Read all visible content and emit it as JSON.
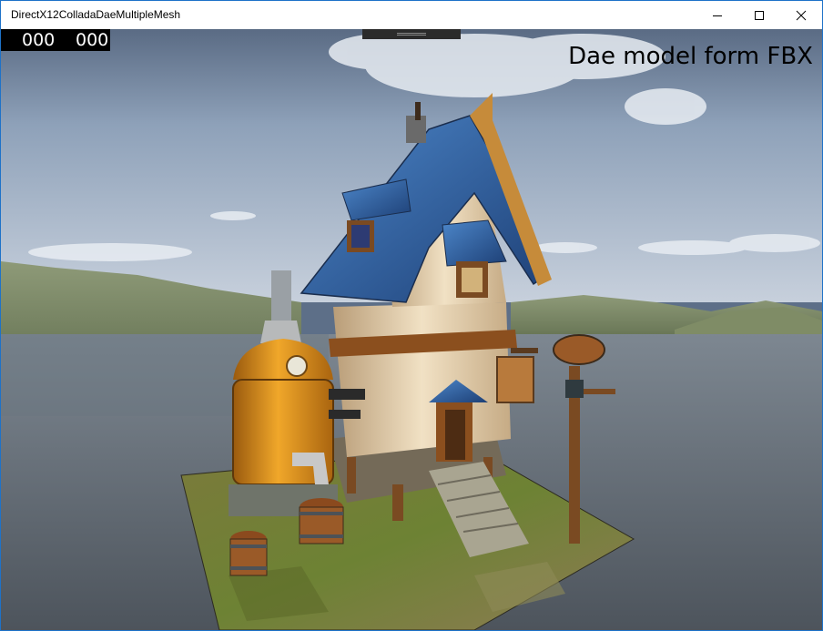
{
  "window": {
    "title": "DirectX12ColladaDaeMultipleMesh",
    "minimize_label": "minimize",
    "maximize_label": "maximize",
    "close_label": "close"
  },
  "overlay": {
    "counter_left": "000",
    "counter_right": "000",
    "caption": "Dae model form FBX"
  },
  "colors": {
    "window_border": "#1e72c8",
    "sky": "#7f93ab",
    "water": "#5c6570",
    "roof": "#2f5f9f",
    "boiler": "#d58a1c"
  }
}
